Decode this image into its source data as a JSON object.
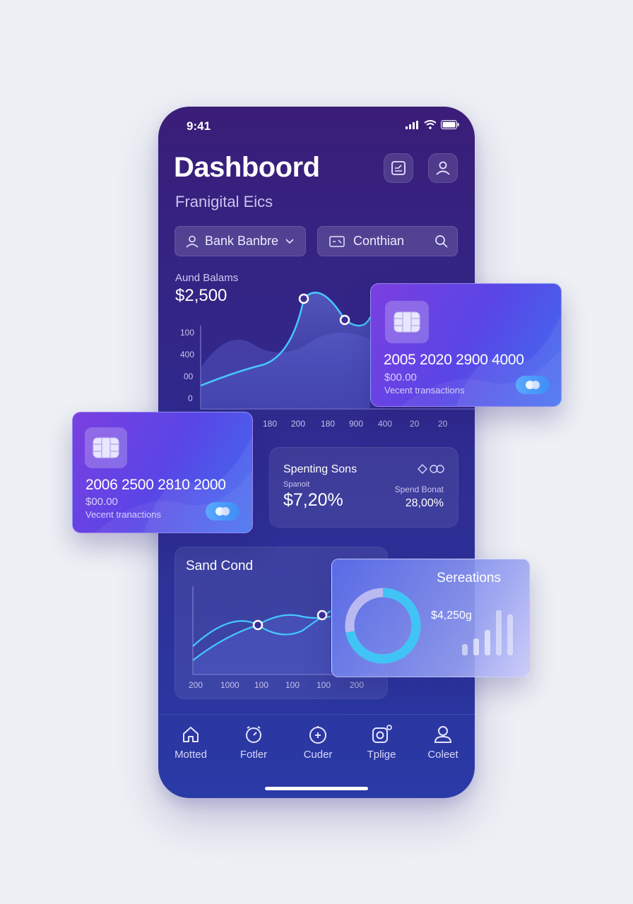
{
  "status": {
    "time": "9:41"
  },
  "header": {
    "title": "Dashboord",
    "subtitle": "Franigital Eics"
  },
  "filters": {
    "bank_label": "Bank Banbre",
    "search_label": "Conthian"
  },
  "balance_chart": {
    "label": "Aund Balams",
    "value": "$2,500",
    "y_ticks": [
      "100",
      "400",
      "00",
      "0"
    ],
    "x_ticks": [
      "180",
      "200",
      "180",
      "900",
      "400",
      "20",
      "20"
    ]
  },
  "card_right": {
    "number": "2005 2020 2900 4000",
    "amount": "$00.00",
    "caption": "Vecent transactions"
  },
  "card_left": {
    "number": "2006 2500 2810 2000",
    "amount": "$00.00",
    "caption": "Vecent tranactions"
  },
  "spending": {
    "title": "Spenting Sons",
    "left_caption": "Spanoit",
    "left_value": "$7,20%",
    "right_caption": "Spend Bonat",
    "right_value": "28,00%"
  },
  "second_chart": {
    "title": "Sand Cond",
    "x_ticks": [
      "200",
      "1000",
      "100",
      "100",
      "100",
      "200"
    ]
  },
  "glass_card": {
    "title": "Sereations",
    "value": "$4,250g",
    "donut_fraction": 0.72
  },
  "nav": {
    "items": [
      {
        "label": "Motted",
        "icon": "home-icon"
      },
      {
        "label": "Fotler",
        "icon": "timer-icon"
      },
      {
        "label": "Cuder",
        "icon": "compass-icon"
      },
      {
        "label": "Tplige",
        "icon": "camera-icon"
      },
      {
        "label": "Coleet",
        "icon": "user-icon"
      }
    ]
  },
  "colors": {
    "phone_top": "#3a1d78",
    "phone_bottom": "#2a3aa6",
    "accent_line": "#45c8ff",
    "card_purple": "#7b3fe0",
    "card_blue": "#3f6ef0"
  }
}
